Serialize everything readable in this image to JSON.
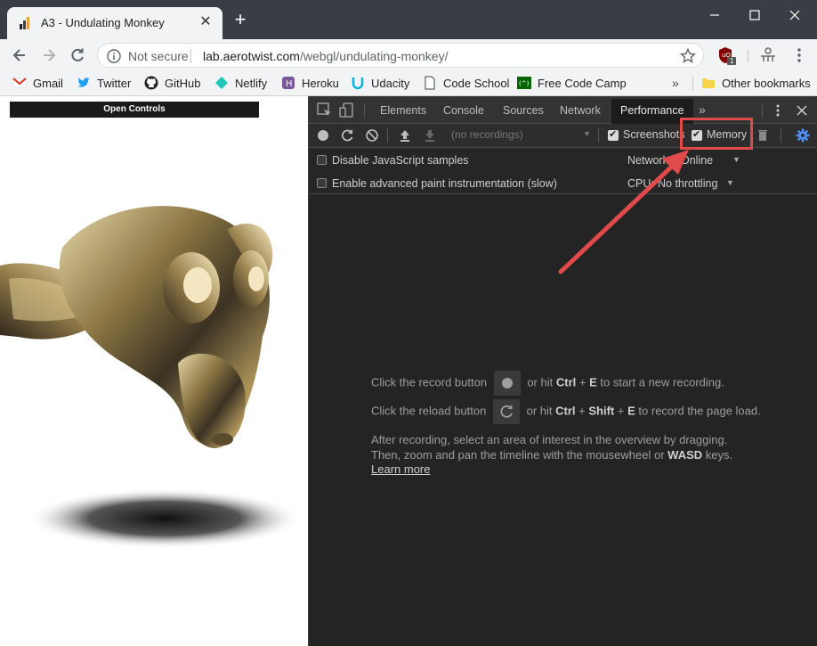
{
  "browser": {
    "tab_title": "A3 - Undulating Monkey",
    "new_tab_symbol": "+",
    "close_symbol": "✕"
  },
  "omnibox": {
    "security_text": "Not secure",
    "url_host": "lab.aerotwist.com",
    "url_path": "/webgl/undulating-monkey/"
  },
  "extensions": {
    "badge_count": "1"
  },
  "bookmarks": {
    "items": [
      "Gmail",
      "Twitter",
      "GitHub",
      "Netlify",
      "Heroku",
      "Udacity",
      "Code School",
      "Free Code Camp"
    ],
    "more": "»",
    "other": "Other bookmarks"
  },
  "page": {
    "open_controls": "Open Controls"
  },
  "devtools": {
    "tabs": [
      "Elements",
      "Console",
      "Sources",
      "Network",
      "Performance"
    ],
    "active_tab": "Performance",
    "more_tabs": "»",
    "recordings_placeholder": "(no recordings)",
    "screenshots_label": "Screenshots",
    "memory_label": "Memory",
    "disable_js_samples": "Disable JavaScript samples",
    "enable_paint": "Enable advanced paint instrumentation (slow)",
    "network_label": "Network:",
    "network_value": "Online",
    "cpu_label": "CPU:",
    "cpu_value": "No throttling",
    "hint1_pre": "Click the record button",
    "hint1_mid": "or hit",
    "hint1_key1": "Ctrl",
    "hint1_plus": "+",
    "hint1_key2": "E",
    "hint1_post": "to start a new recording.",
    "hint2_pre": "Click the reload button",
    "hint2_mid": "or hit",
    "hint2_key1": "Ctrl",
    "hint2_plus1": "+",
    "hint2_key2": "Shift",
    "hint2_plus2": "+",
    "hint2_key3": "E",
    "hint2_post": "to record the page load.",
    "hint3_line1": "After recording, select an area of interest in the overview by dragging.",
    "hint3_line2_pre": "Then, zoom and pan the timeline with the mousewheel or",
    "hint3_line2_key": "WASD",
    "hint3_line2_post": "keys.",
    "learn_more": "Learn more"
  },
  "colors": {
    "highlight": "#e04a4a",
    "devtools_bg": "#242424",
    "settings_gear": "#4d90fe"
  }
}
